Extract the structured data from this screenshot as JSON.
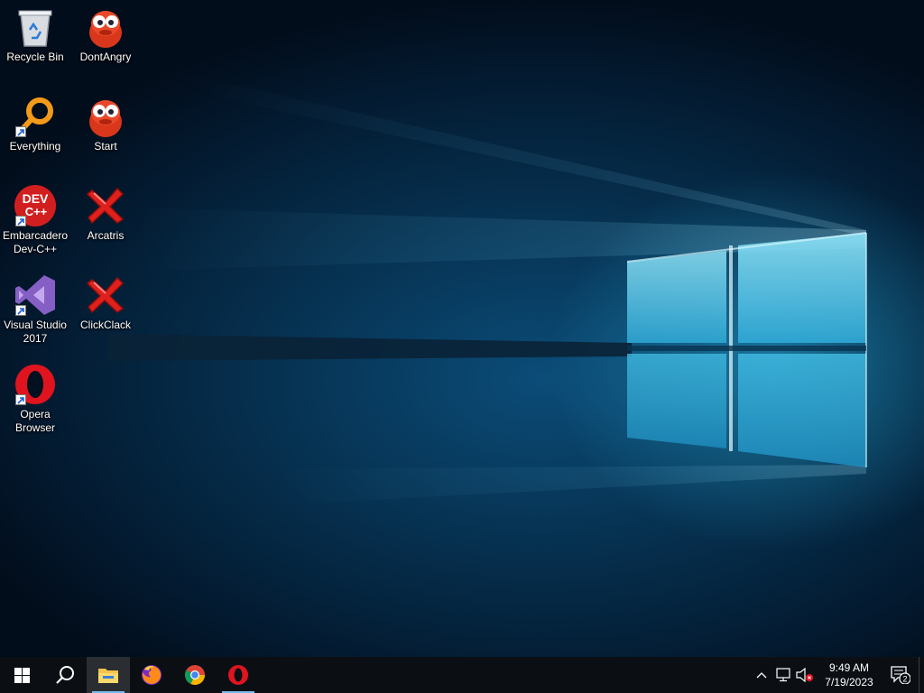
{
  "desktop": {
    "icons": [
      {
        "label": "Recycle Bin"
      },
      {
        "label": "DontAngry"
      },
      {
        "label": "Everything"
      },
      {
        "label": "Start"
      },
      {
        "label": "Embarcadero Dev-C++",
        "glyph_text": "DEV C++"
      },
      {
        "label": "Arcatris"
      },
      {
        "label": "Visual Studio 2017"
      },
      {
        "label": "ClickClack"
      },
      {
        "label": "Opera Browser"
      }
    ]
  },
  "taskbar": {
    "items": [
      {
        "name": "start-button",
        "icon": "windows-logo-icon"
      },
      {
        "name": "search-button",
        "icon": "search-icon"
      },
      {
        "name": "file-explorer",
        "icon": "folder-icon"
      },
      {
        "name": "firefox",
        "icon": "firefox-icon"
      },
      {
        "name": "chrome",
        "icon": "chrome-icon"
      },
      {
        "name": "opera",
        "icon": "opera-icon"
      }
    ],
    "clock": {
      "time": "9:49 AM",
      "date": "7/19/2023"
    },
    "notification_count": "2"
  },
  "colors": {
    "taskbar_bg": "#0b0f14",
    "accent": "#76b9ed",
    "opera_red": "#e0141f",
    "vs_purple": "#865fc5"
  }
}
